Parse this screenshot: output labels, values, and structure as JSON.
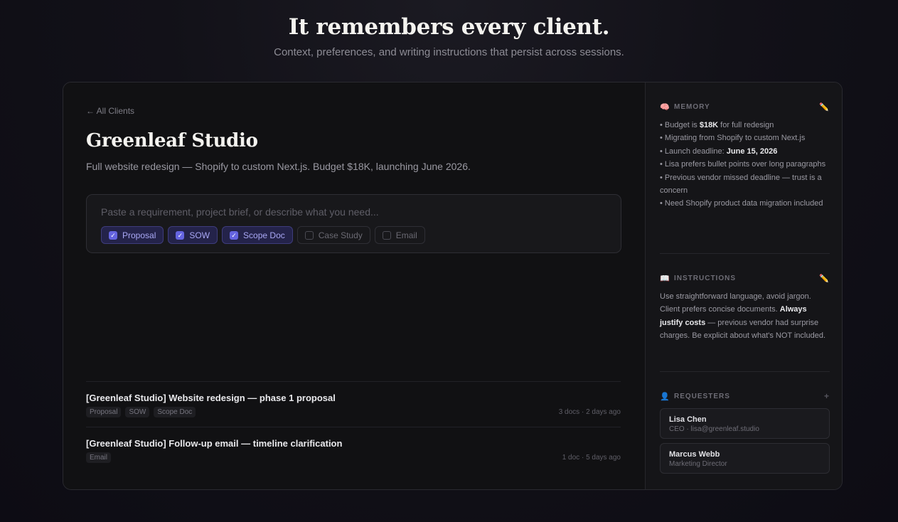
{
  "hero": {
    "title": "It remembers every client.",
    "subtitle": "Context, preferences, and writing instructions that persist across sessions."
  },
  "main": {
    "back_link": "← All Clients",
    "client_name": "Greenleaf Studio",
    "client_description": "Full website redesign — Shopify to custom Next.js. Budget $18K, launching June 2026.",
    "composer": {
      "placeholder": "Paste a requirement, project brief, or describe what you need...",
      "value": "",
      "chips": [
        {
          "label": "Proposal",
          "checked": true
        },
        {
          "label": "SOW",
          "checked": true
        },
        {
          "label": "Scope Doc",
          "checked": true
        },
        {
          "label": "Case Study",
          "checked": false
        },
        {
          "label": "Email",
          "checked": false
        }
      ]
    },
    "documents": [
      {
        "title": "[Greenleaf Studio] Website redesign — phase 1 proposal",
        "tags": [
          "Proposal",
          "SOW",
          "Scope Doc"
        ],
        "meta": "3 docs · 2 days ago"
      },
      {
        "title": "[Greenleaf Studio] Follow-up email — timeline clarification",
        "tags": [
          "Email"
        ],
        "meta": "1 doc · 5 days ago"
      }
    ]
  },
  "sidebar": {
    "memory": {
      "heading": "MEMORY",
      "icon": "brain-icon",
      "items": [
        {
          "before": "• Budget is ",
          "bold": "$18K",
          "after": " for full redesign"
        },
        {
          "before": "• Migrating from Shopify to custom Next.js",
          "bold": "",
          "after": ""
        },
        {
          "before": "• Launch deadline: ",
          "bold": "June 15, 2026",
          "after": ""
        },
        {
          "before": "• Lisa prefers bullet points over long paragraphs",
          "bold": "",
          "after": ""
        },
        {
          "before": "• Previous vendor missed deadline — trust is a concern",
          "bold": "",
          "after": ""
        },
        {
          "before": "• Need Shopify product data migration included",
          "bold": "",
          "after": ""
        }
      ]
    },
    "instructions": {
      "heading": "INSTRUCTIONS",
      "icon": "book-icon",
      "text_before": "Use straightforward language, avoid jargon. Client prefers concise documents. ",
      "text_bold": "Always justify costs",
      "text_after": " — previous vendor had surprise charges. Be explicit about what's NOT included."
    },
    "requesters": {
      "heading": "REQUESTERS",
      "icon": "person-icon",
      "add_label": "+",
      "people": [
        {
          "name": "Lisa Chen",
          "role": "CEO · lisa@greenleaf.studio"
        },
        {
          "name": "Marcus Webb",
          "role": "Marketing Director"
        }
      ]
    }
  },
  "colors": {
    "accent": "#6564e0",
    "chip_on_bg": "#24234a",
    "chip_on_text": "#a9a8f5",
    "background": "#0c0b13",
    "card": "#111113"
  }
}
